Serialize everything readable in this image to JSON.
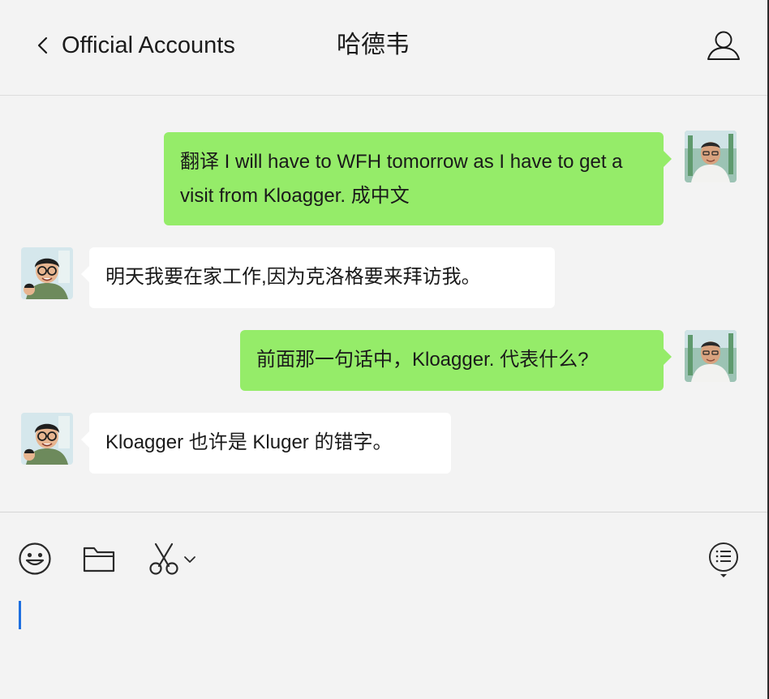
{
  "header": {
    "back_label": "Official Accounts",
    "title": "哈德韦",
    "back_icon": "chevron-left-icon",
    "profile_icon": "person-icon"
  },
  "messages": [
    {
      "sender": "me",
      "text": "翻译 I will have to WFH tomorrow as I have to get a visit from Kloagger. 成中文"
    },
    {
      "sender": "them",
      "text": "明天我要在家工作,因为克洛格要来拜访我。"
    },
    {
      "sender": "me",
      "text": "前面那一句话中，Kloagger. 代表什么?"
    },
    {
      "sender": "them",
      "text": "Kloagger 也许是 Kluger 的错字。"
    }
  ],
  "toolbar": {
    "icons": [
      "emoji-icon",
      "folder-icon",
      "scissors-icon",
      "chevron-down-icon",
      "chat-history-icon"
    ]
  },
  "input": {
    "value": ""
  },
  "colors": {
    "outgoing_bubble": "#95ec69",
    "incoming_bubble": "#ffffff",
    "background": "#f3f3f3",
    "caret": "#1e6fe0"
  }
}
